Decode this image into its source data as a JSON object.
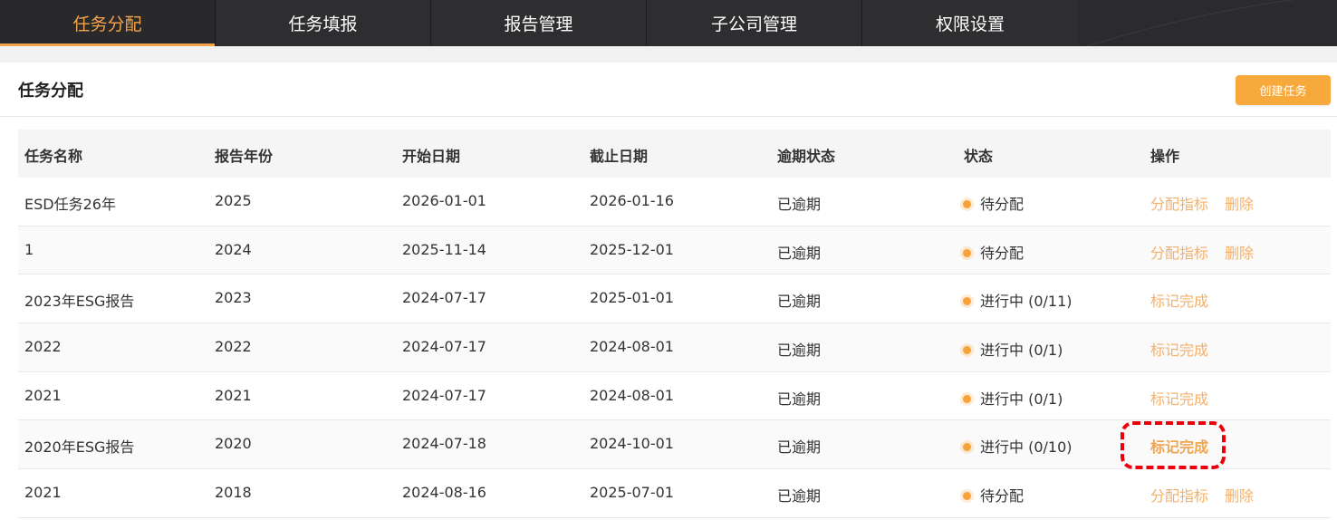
{
  "nav": {
    "tabs": [
      {
        "label": "任务分配",
        "active": true
      },
      {
        "label": "任务填报",
        "active": false
      },
      {
        "label": "报告管理",
        "active": false
      },
      {
        "label": "子公司管理",
        "active": false
      },
      {
        "label": "权限设置",
        "active": false
      }
    ]
  },
  "panel": {
    "title": "任务分配",
    "create_button": "创建任务"
  },
  "table": {
    "headers": [
      "任务名称",
      "报告年份",
      "开始日期",
      "截止日期",
      "逾期状态",
      "状态",
      "操作"
    ],
    "rows": [
      {
        "name": "ESD任务26年",
        "year": "2025",
        "start": "2026-01-01",
        "end": "2026-01-16",
        "overdue": "已逾期",
        "status": "待分配",
        "ops": [
          "分配指标",
          "删除"
        ]
      },
      {
        "name": "1",
        "year": "2024",
        "start": "2025-11-14",
        "end": "2025-12-01",
        "overdue": "已逾期",
        "status": "待分配",
        "ops": [
          "分配指标",
          "删除"
        ]
      },
      {
        "name": "2023年ESG报告",
        "year": "2023",
        "start": "2024-07-17",
        "end": "2025-01-01",
        "overdue": "已逾期",
        "status": "进行中 (0/11)",
        "ops": [
          "标记完成"
        ]
      },
      {
        "name": "2022",
        "year": "2022",
        "start": "2024-07-17",
        "end": "2024-08-01",
        "overdue": "已逾期",
        "status": "进行中 (0/1)",
        "ops": [
          "标记完成"
        ]
      },
      {
        "name": "2021",
        "year": "2021",
        "start": "2024-07-17",
        "end": "2024-08-01",
        "overdue": "已逾期",
        "status": "进行中 (0/1)",
        "ops": [
          "标记完成"
        ]
      },
      {
        "name": "2020年ESG报告",
        "year": "2020",
        "start": "2024-07-18",
        "end": "2024-10-01",
        "overdue": "已逾期",
        "status": "进行中 (0/10)",
        "ops": [
          "标记完成"
        ]
      },
      {
        "name": "2021",
        "year": "2018",
        "start": "2024-08-16",
        "end": "2025-07-01",
        "overdue": "已逾期",
        "status": "待分配",
        "ops": [
          "分配指标",
          "删除"
        ]
      }
    ]
  },
  "colors": {
    "accent": "#f5a34a",
    "nav_bg": "#2b2b2e",
    "highlight": "#e8000b"
  }
}
